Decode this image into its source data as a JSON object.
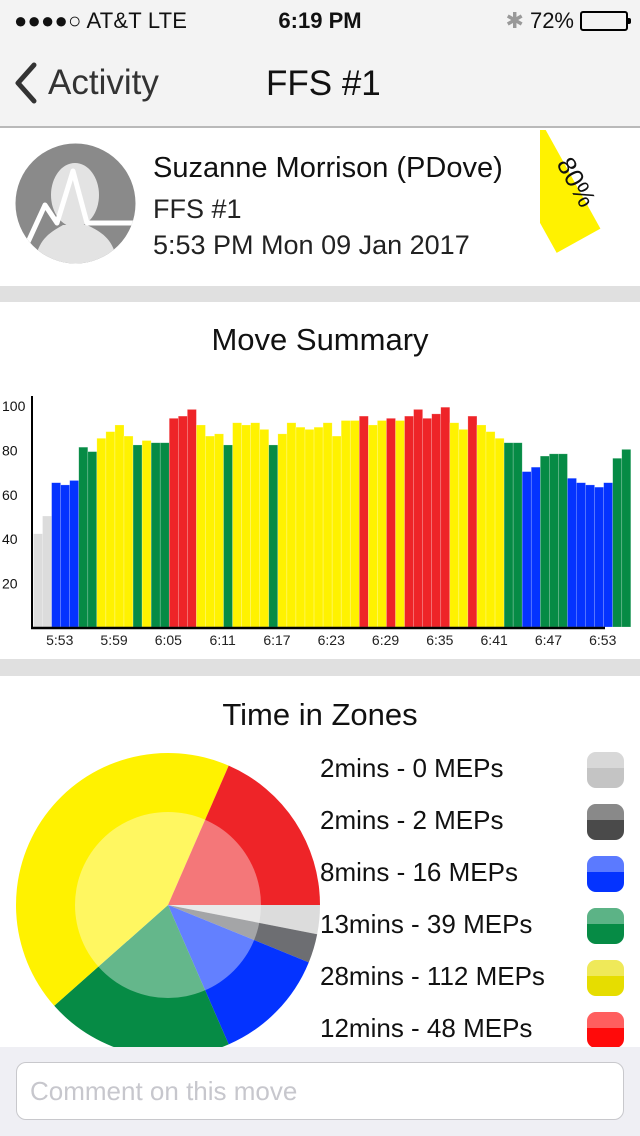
{
  "status_bar": {
    "carrier": "●●●●○ AT&T  LTE",
    "time": "6:19 PM",
    "battery_text": "72%",
    "battery_level": 0.72,
    "bluetooth_icon": "bluetooth-icon"
  },
  "nav": {
    "back_label": "Activity",
    "title": "FFS #1"
  },
  "profile": {
    "name": "Suzanne Morrison (PDove)",
    "activity": "FFS #1",
    "datetime": "5:53 PM Mon 09 Jan 2017",
    "badge": "80%",
    "badge_color": "#fff200"
  },
  "move_summary": {
    "title": "Move Summary"
  },
  "time_in_zones": {
    "title": "Time in Zones"
  },
  "comment": {
    "placeholder": "Comment on this move",
    "value": ""
  },
  "zone_colors": {
    "gray_light": "#dcdcdc",
    "gray_dark": "#6d6e72",
    "blue": "#0433ff",
    "green": "#068b45",
    "yellow": "#fff200",
    "red": "#ee2428"
  },
  "chart_data": [
    {
      "type": "bar",
      "title": "Move Summary",
      "xlabel": "",
      "ylabel": "",
      "ylim": [
        0,
        100
      ],
      "yticks": [
        20,
        40,
        60,
        80,
        100
      ],
      "xtick_labels": [
        "5:53",
        "5:59",
        "6:05",
        "6:11",
        "6:17",
        "6:23",
        "6:29",
        "6:35",
        "6:41",
        "6:47",
        "6:53"
      ],
      "xtick_every": 6,
      "grid": false,
      "values": [
        42,
        50,
        65,
        64,
        66,
        81,
        79,
        85,
        88,
        91,
        86,
        82,
        84,
        83,
        83,
        94,
        95,
        98,
        91,
        86,
        87,
        82,
        92,
        91,
        92,
        89,
        82,
        87,
        92,
        90,
        89,
        90,
        92,
        86,
        93,
        93,
        95,
        91,
        93,
        94,
        93,
        95,
        98,
        94,
        96,
        99,
        92,
        89,
        95,
        91,
        88,
        85,
        83,
        83,
        70,
        72,
        77,
        78,
        78,
        67,
        65,
        64,
        63,
        65,
        76,
        80
      ],
      "zones": [
        "gray_light",
        "gray_light",
        "blue",
        "blue",
        "blue",
        "green",
        "green",
        "yellow",
        "yellow",
        "yellow",
        "yellow",
        "green",
        "yellow",
        "green",
        "green",
        "red",
        "red",
        "red",
        "yellow",
        "yellow",
        "yellow",
        "green",
        "yellow",
        "yellow",
        "yellow",
        "yellow",
        "green",
        "yellow",
        "yellow",
        "yellow",
        "yellow",
        "yellow",
        "yellow",
        "yellow",
        "yellow",
        "yellow",
        "red",
        "yellow",
        "yellow",
        "red",
        "yellow",
        "red",
        "red",
        "red",
        "red",
        "red",
        "yellow",
        "yellow",
        "red",
        "yellow",
        "yellow",
        "yellow",
        "green",
        "green",
        "blue",
        "blue",
        "green",
        "green",
        "green",
        "blue",
        "blue",
        "blue",
        "blue",
        "blue",
        "green",
        "green"
      ]
    },
    {
      "type": "pie",
      "title": "Time in Zones",
      "start_angle": "3 o'clock",
      "direction": "clockwise",
      "slices": [
        {
          "zone": "gray_light",
          "minutes": 2,
          "meps": 0,
          "label": "2mins - 0 MEPs",
          "color": "#dcdcdc",
          "legend_color": "#c4c4c4"
        },
        {
          "zone": "gray_dark",
          "minutes": 2,
          "meps": 2,
          "label": "2mins - 2 MEPs",
          "color": "#6d6e72",
          "legend_color": "#4a4a4a"
        },
        {
          "zone": "blue",
          "minutes": 8,
          "meps": 16,
          "label": "8mins - 16 MEPs",
          "color": "#0433ff",
          "legend_color": "#0433ff"
        },
        {
          "zone": "green",
          "minutes": 13,
          "meps": 39,
          "label": "13mins - 39 MEPs",
          "color": "#068b45",
          "legend_color": "#068b45"
        },
        {
          "zone": "yellow",
          "minutes": 28,
          "meps": 112,
          "label": "28mins - 112 MEPs",
          "color": "#fff200",
          "legend_color": "#e6dd00"
        },
        {
          "zone": "red",
          "minutes": 12,
          "meps": 48,
          "label": "12mins - 48 MEPs",
          "color": "#ee2428",
          "legend_color": "#ff0a0a"
        }
      ]
    }
  ]
}
